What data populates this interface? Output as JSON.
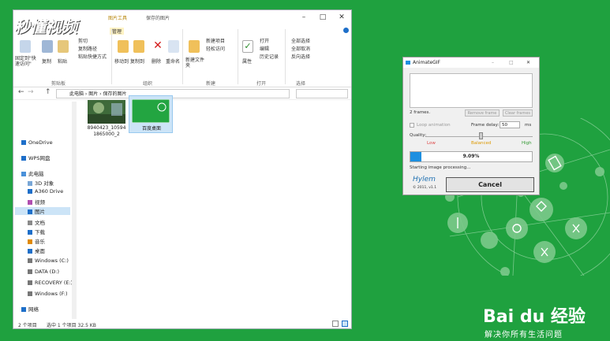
{
  "explorer": {
    "title_tab": "图片工具",
    "title": "保存的图片",
    "ribbon": {
      "tab_manage": "管理",
      "pin_label": "固定到\"快速访问\"",
      "copy_label": "复制",
      "paste_label": "粘贴",
      "cut_label": "剪切",
      "copy_path_label": "复制路径",
      "paste_shortcut_label": "粘贴快捷方式",
      "move_to_label": "移动到",
      "copy_to_label": "复制到",
      "delete_label": "删除",
      "rename_label": "重命名",
      "new_folder_label": "新建文件夹",
      "new_item_label": "新建项目",
      "easy_access_label": "轻松访问",
      "properties_label": "属性",
      "open_label": "打开",
      "edit_label": "编辑",
      "history_label": "历史记录",
      "select_all_label": "全部选择",
      "select_none_label": "全部取消",
      "invert_label": "反向选择",
      "group_clipboard": "剪贴板",
      "group_organize": "组织",
      "group_new": "新建",
      "group_open": "打开",
      "group_select": "选择"
    },
    "address": {
      "crumb1": "此电脑",
      "crumb2": "图片",
      "crumb3": "保存的图片"
    },
    "nav": [
      "OneDrive",
      "WPS网盘",
      "此电脑",
      "3D 对象",
      "A360 Drive",
      "视频",
      "图片",
      "文档",
      "下载",
      "音乐",
      "桌面",
      "Windows (C:)",
      "DATA (D:)",
      "RECOVERY (E:)",
      "Windows (F:)",
      "网络"
    ],
    "files": [
      {
        "name": "8940423_105941865000_2"
      },
      {
        "name": "百度桌面"
      }
    ],
    "status": {
      "count": "2 个项目",
      "selected": "选中 1 个项目  32.5 KB"
    }
  },
  "animategif": {
    "title": "AnimateGIF",
    "frames": "2 frames.",
    "btn_remove": "Remove frame",
    "btn_clear": "Clear frames",
    "loop": "Loop animation",
    "frame_delay_label": "Frame delay:",
    "frame_delay_value": "50",
    "frame_delay_unit": "ms",
    "quality_label": "Quality:",
    "q_low": "Low",
    "q_balanced": "Balanced",
    "q_high": "High",
    "progress_text": "9.09%",
    "progress_value": 0.0909,
    "status_text": "Starting image processing...",
    "brand": "Hylem",
    "copyright": "© 2011, v1.1",
    "cancel": "Cancel"
  },
  "watermark": "秒懂视频",
  "baidu": {
    "logo": "Bai du 经验",
    "slogan": "解决你所有生活问题"
  },
  "colors": {
    "background": "#1fa13f",
    "progress": "#1d8fe0",
    "accent": "#0078d7"
  }
}
